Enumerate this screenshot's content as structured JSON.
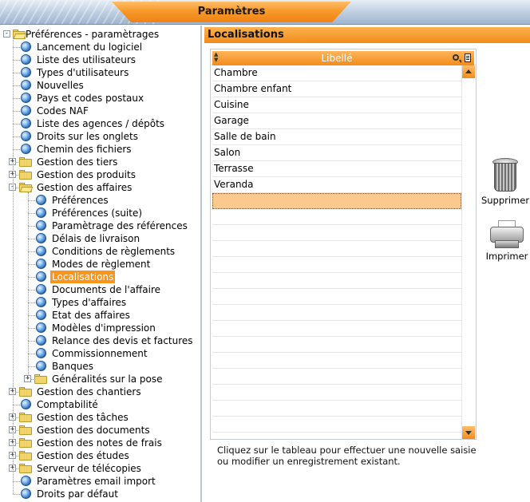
{
  "window": {
    "title": "Paramètres"
  },
  "tree": {
    "root_label": "Préférences - paramètrages",
    "items": [
      {
        "label": "Lancement du logiciel",
        "icon": "globe-icon",
        "level": 1
      },
      {
        "label": "Liste des utilisateurs",
        "icon": "globe-icon",
        "level": 1
      },
      {
        "label": "Types d'utilisateurs",
        "icon": "globe-icon",
        "level": 1
      },
      {
        "label": "Nouvelles",
        "icon": "globe-icon",
        "level": 1
      },
      {
        "label": "Pays et codes postaux",
        "icon": "globe-icon",
        "level": 1
      },
      {
        "label": "Codes NAF",
        "icon": "globe-icon",
        "level": 1
      },
      {
        "label": "Liste des agences / dépôts",
        "icon": "globe-icon",
        "level": 1
      },
      {
        "label": "Droits sur les onglets",
        "icon": "globe-icon",
        "level": 1
      },
      {
        "label": "Chemin des fichiers",
        "icon": "globe-icon",
        "level": 1
      },
      {
        "label": "Gestion des tiers",
        "icon": "folder-icon",
        "level": 1,
        "expander": "+"
      },
      {
        "label": "Gestion des produits",
        "icon": "folder-icon",
        "level": 1,
        "expander": "+"
      },
      {
        "label": "Gestion des affaires",
        "icon": "folder-open-icon",
        "level": 1,
        "expander": "-"
      },
      {
        "label": "Préférences",
        "icon": "globe-icon",
        "level": 2
      },
      {
        "label": "Préférences (suite)",
        "icon": "globe-icon",
        "level": 2
      },
      {
        "label": "Paramètrage des références",
        "icon": "globe-icon",
        "level": 2
      },
      {
        "label": "Délais de livraison",
        "icon": "globe-icon",
        "level": 2
      },
      {
        "label": "Conditions de règlements",
        "icon": "globe-icon",
        "level": 2
      },
      {
        "label": "Modes de règlement",
        "icon": "globe-icon",
        "level": 2
      },
      {
        "label": "Localisations",
        "icon": "globe-icon",
        "level": 2,
        "selected": true
      },
      {
        "label": "Documents de l'affaire",
        "icon": "globe-icon",
        "level": 2
      },
      {
        "label": "Types d'affaires",
        "icon": "globe-icon",
        "level": 2
      },
      {
        "label": "Etat des affaires",
        "icon": "globe-icon",
        "level": 2
      },
      {
        "label": "Modèles d'impression",
        "icon": "globe-icon",
        "level": 2
      },
      {
        "label": "Relance des devis et factures",
        "icon": "globe-icon",
        "level": 2
      },
      {
        "label": "Commissionnement",
        "icon": "globe-icon",
        "level": 2
      },
      {
        "label": "Banques",
        "icon": "globe-icon",
        "level": 2
      },
      {
        "label": "Généralités sur la pose",
        "icon": "folder-icon",
        "level": 2,
        "expander": "+"
      },
      {
        "label": "Gestion des chantiers",
        "icon": "folder-icon",
        "level": 1,
        "expander": "+"
      },
      {
        "label": "Comptabilité",
        "icon": "globe-icon",
        "level": 1
      },
      {
        "label": "Gestion des tâches",
        "icon": "folder-icon",
        "level": 1,
        "expander": "+"
      },
      {
        "label": "Gestion des documents",
        "icon": "folder-icon",
        "level": 1,
        "expander": "+"
      },
      {
        "label": "Gestion des notes de frais",
        "icon": "folder-icon",
        "level": 1,
        "expander": "+"
      },
      {
        "label": "Gestion des études",
        "icon": "folder-icon",
        "level": 1,
        "expander": "+"
      },
      {
        "label": "Serveur de télécopies",
        "icon": "folder-icon",
        "level": 1,
        "expander": "+"
      },
      {
        "label": "Paramètres email import",
        "icon": "globe-icon",
        "level": 1
      },
      {
        "label": "Droits par défaut",
        "icon": "globe-icon",
        "level": 1
      }
    ]
  },
  "panel": {
    "title": "Localisations",
    "grid": {
      "column_header": "Libellé",
      "rows": [
        "Chambre",
        "Chambre enfant",
        "Cuisine",
        "Garage",
        "Salle de bain",
        "Salon",
        "Terrasse",
        "Veranda"
      ],
      "new_row_value": "",
      "empty_rows": 14
    },
    "hint": "Cliquez sur le tableau pour effectuer une nouvelle saisie ou modifier un enregistrement existant."
  },
  "actions": {
    "delete_label": "Supprimer",
    "print_label": "Imprimer"
  },
  "colors": {
    "accent": "#f28c1b",
    "selection": "#f7951c",
    "new_row": "#fbc98e"
  }
}
